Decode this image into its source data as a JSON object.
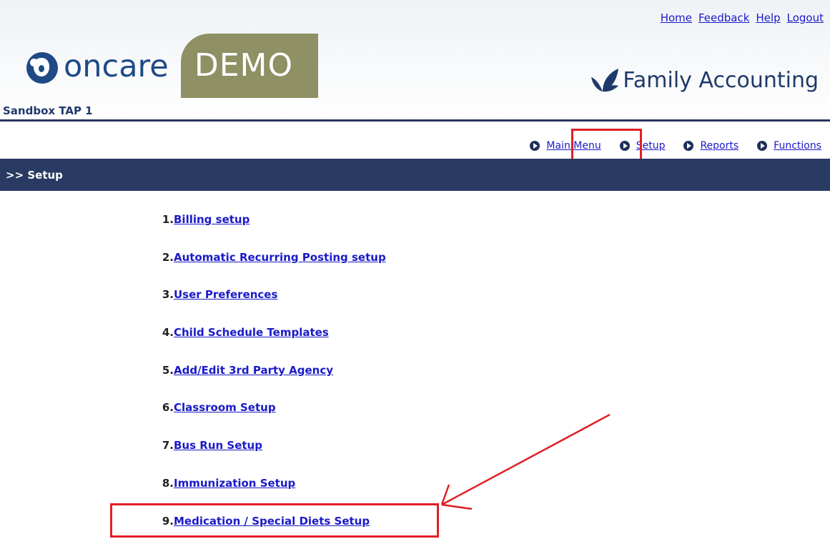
{
  "top_links": [
    "Home",
    "Feedback",
    "Help",
    "Logout"
  ],
  "logo": {
    "brand": "oncare",
    "badge": "DEMO",
    "badge_color": "#8f9063",
    "brand_color": "#1f4a86"
  },
  "product": {
    "name": "Family Accounting",
    "icon": "leaf-icon"
  },
  "org_name": "Sandbox TAP 1",
  "nav": [
    {
      "label": "Main Menu",
      "icon": "play-circle-icon"
    },
    {
      "label": "Setup",
      "icon": "play-circle-icon",
      "highlighted": true
    },
    {
      "label": "Reports",
      "icon": "play-circle-icon"
    },
    {
      "label": "Functions",
      "icon": "play-circle-icon"
    }
  ],
  "section_title": ">> Setup",
  "setup_items": [
    {
      "num": "1.",
      "label": "Billing setup"
    },
    {
      "num": "2.",
      "label": "Automatic Recurring Posting setup"
    },
    {
      "num": "3.",
      "label": "User Preferences"
    },
    {
      "num": "4.",
      "label": "Child Schedule Templates"
    },
    {
      "num": "5.",
      "label": "Add/Edit 3rd Party Agency"
    },
    {
      "num": "6.",
      "label": "Classroom Setup"
    },
    {
      "num": "7.",
      "label": "Bus Run Setup"
    },
    {
      "num": "8.",
      "label": "Immunization Setup"
    },
    {
      "num": "9.",
      "label": "Medication / Special Diets Setup",
      "highlighted": true
    }
  ],
  "colors": {
    "link": "#1a1ac8",
    "section_bar": "#293a63",
    "annotation": "#e21e26"
  }
}
